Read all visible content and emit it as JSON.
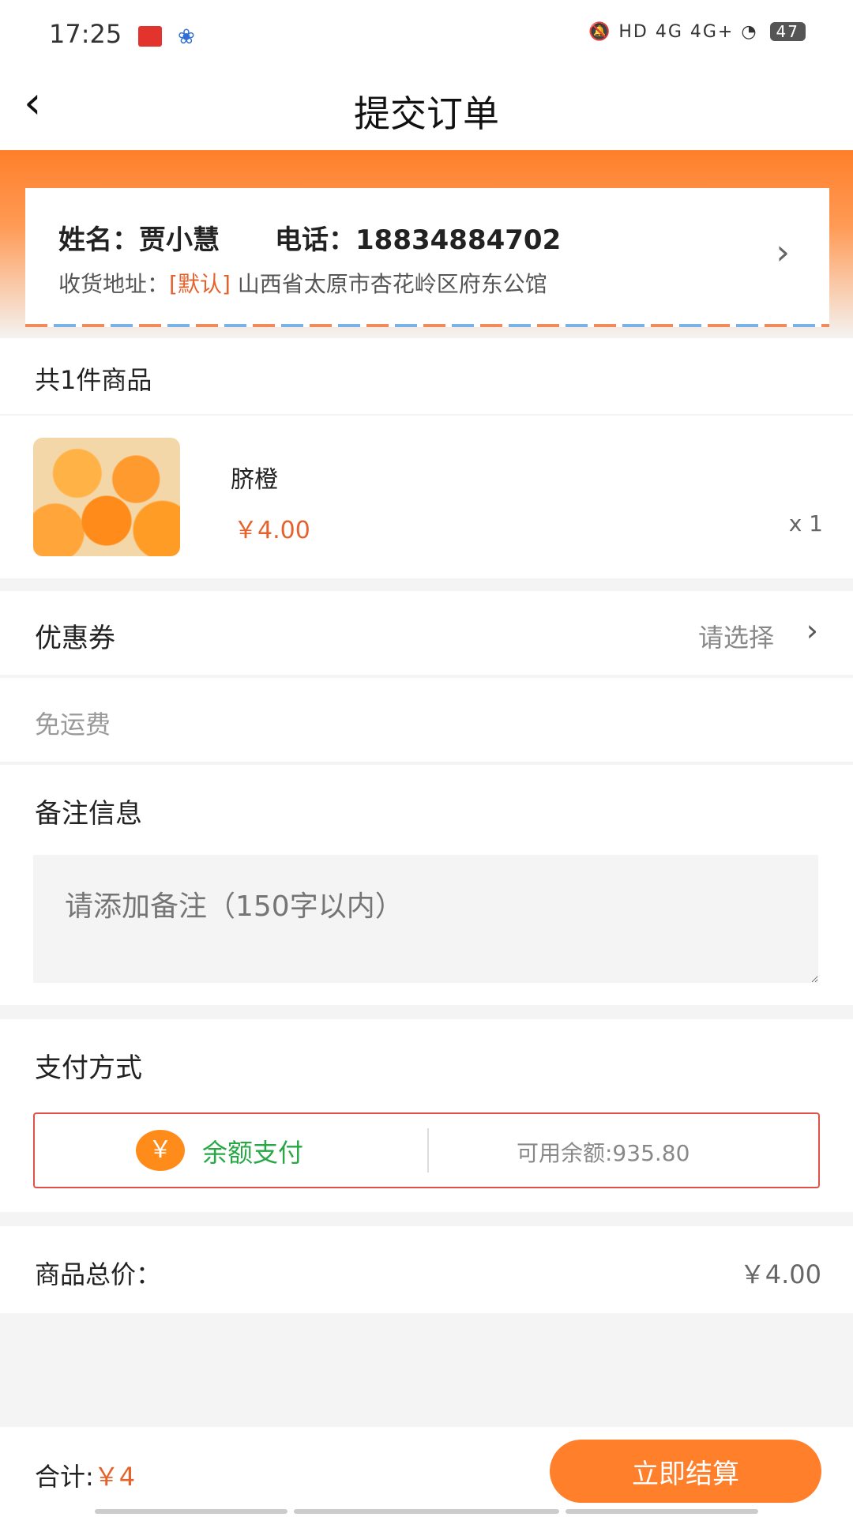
{
  "status_bar": {
    "time": "17:25",
    "network": "HD 4G 4G+",
    "battery": "47"
  },
  "header": {
    "title": "提交订单"
  },
  "address": {
    "name_label": "姓名：",
    "name": "贾小慧",
    "phone_label": "电话：",
    "phone": "18834884702",
    "address_label": "收货地址：",
    "default_tag": "[默认]",
    "address": "山西省太原市杏花岭区府东公馆"
  },
  "items": {
    "count_text": "共1件商品"
  },
  "product": {
    "name": "脐橙",
    "price": "￥4.00",
    "qty": "x 1"
  },
  "coupon": {
    "label": "优惠券",
    "value": "请选择"
  },
  "shipping": {
    "label": "免运费"
  },
  "remark": {
    "label": "备注信息",
    "placeholder": "请添加备注（150字以内）"
  },
  "payment": {
    "label": "支付方式",
    "coin_symbol": "￥",
    "method": "余额支付",
    "balance": "可用余额:935.80"
  },
  "total": {
    "label": "商品总价：",
    "value": "￥4.00"
  },
  "bottom": {
    "sum_label": "合计:",
    "sum_value": "￥4",
    "checkout_label": "立即结算"
  }
}
